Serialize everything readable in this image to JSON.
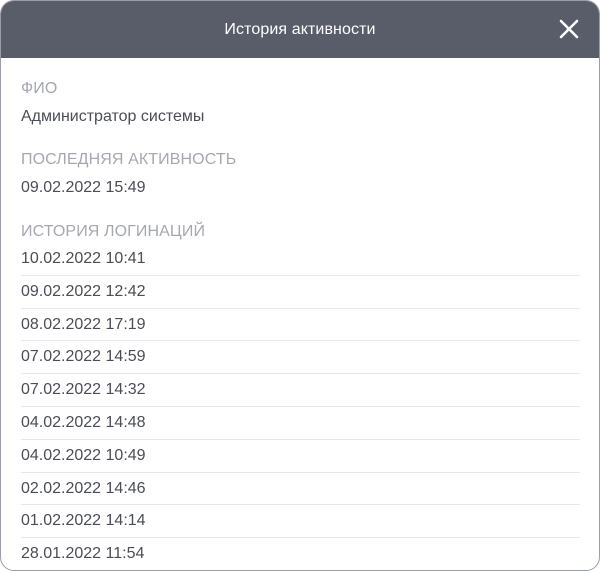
{
  "dialog": {
    "title": "История активности",
    "close_icon": "close-icon"
  },
  "fields": {
    "fio_label": "ФИО",
    "fio_value": "Администратор системы",
    "last_activity_label": "ПОСЛЕДНЯЯ АКТИВНОСТЬ",
    "last_activity_value": "09.02.2022 15:49",
    "login_history_label": "ИСТОРИЯ ЛОГИНАЦИЙ"
  },
  "login_history": [
    "10.02.2022 10:41",
    "09.02.2022 12:42",
    "08.02.2022 17:19",
    "07.02.2022 14:59",
    "07.02.2022 14:32",
    "04.02.2022 14:48",
    "04.02.2022 10:49",
    "02.02.2022 14:46",
    "01.02.2022 14:14",
    "28.01.2022 11:54"
  ],
  "colors": {
    "header_bg": "#585d69",
    "label": "#a5a8b0",
    "text": "#4a4d55",
    "divider": "#e6e7ea"
  }
}
